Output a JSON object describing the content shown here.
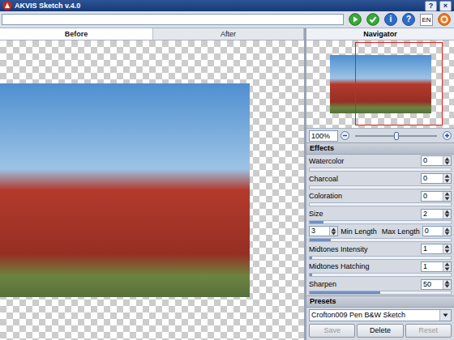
{
  "window": {
    "title": "AKVIS Sketch v.4.0",
    "controls": [
      "?",
      "×"
    ]
  },
  "toolbar": {
    "field": "",
    "info": "i",
    "help": "?",
    "language": "EN"
  },
  "tabs": [
    {
      "label": "Before",
      "selected": true
    },
    {
      "label": "After",
      "selected": false
    }
  ],
  "navigator": {
    "title": "Navigator",
    "zoom": "100%",
    "zoom_level": 0.5
  },
  "effects": {
    "title": "Effects",
    "params": [
      {
        "kind": "slider",
        "label": "Watercolor",
        "value": "0",
        "level": 0
      },
      {
        "kind": "slider",
        "label": "Charcoal",
        "value": "0",
        "level": 0
      },
      {
        "kind": "slider",
        "label": "Coloration",
        "value": "0",
        "level": 0
      },
      {
        "kind": "slider",
        "label": "Size",
        "value": "2",
        "level": 0.1
      },
      {
        "kind": "range",
        "label": "Min Length",
        "value": "3",
        "label2": "Max Length",
        "value2": "0",
        "level": 0.15
      },
      {
        "kind": "slider",
        "label": "Midtones Intensity",
        "value": "1",
        "level": 0.02
      },
      {
        "kind": "slider",
        "label": "Midtones Hatching",
        "value": "1",
        "level": 0.02
      },
      {
        "kind": "slider",
        "label": "Sharpen",
        "value": "50",
        "level": 0.5
      }
    ]
  },
  "presets": {
    "title": "Presets",
    "selected": "Crofton009 Pen B&W Sketch",
    "buttons": [
      {
        "label": "Save",
        "disabled": true
      },
      {
        "label": "Delete",
        "disabled": false
      },
      {
        "label": "Reset",
        "disabled": true
      }
    ]
  }
}
